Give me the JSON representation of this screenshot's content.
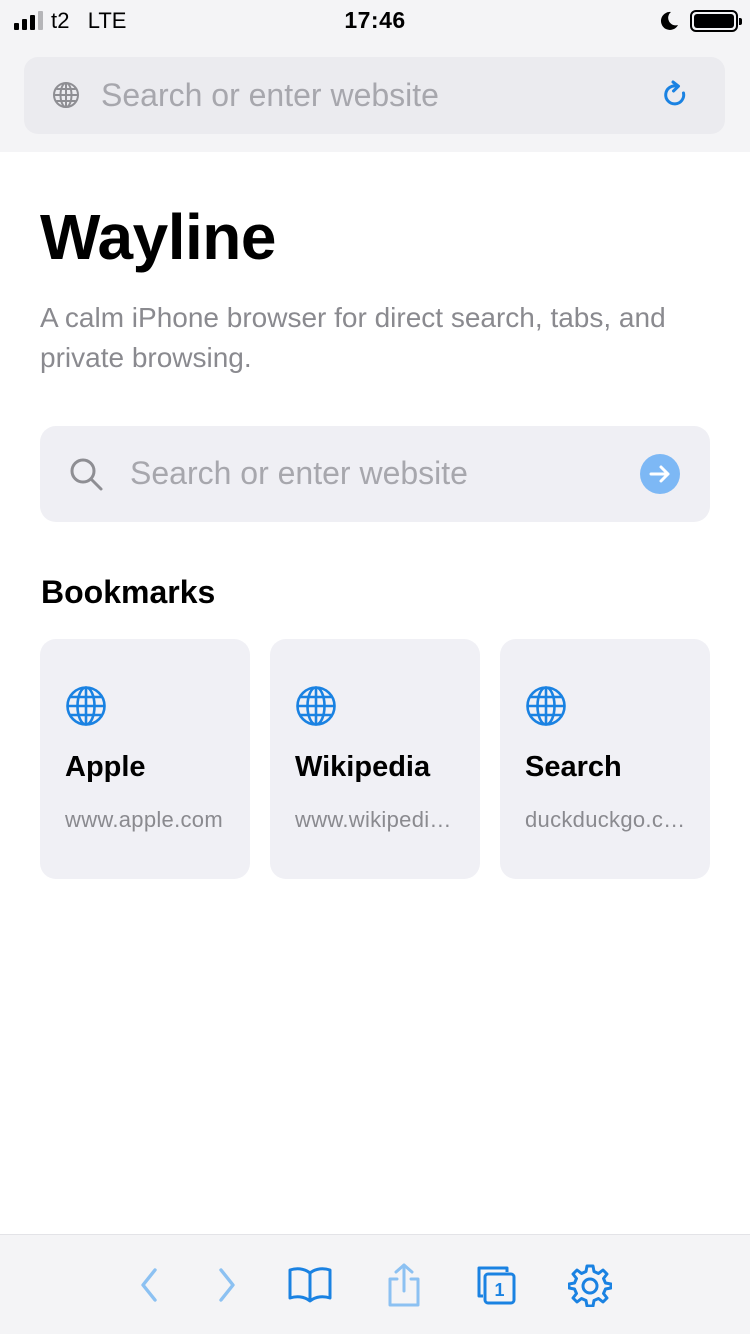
{
  "status_bar": {
    "carrier": "t2",
    "network": "LTE",
    "time": "17:46",
    "signal_bars_active": 3,
    "signal_bars_total": 4,
    "battery_level": 1.0
  },
  "top_bar": {
    "search_placeholder": "Search or enter website",
    "left_icon": "globe-icon",
    "right_icon": "reload-icon"
  },
  "home": {
    "title": "Wayline",
    "subtitle": "A calm iPhone browser for direct search, tabs, and private browsing.",
    "search": {
      "placeholder": "Search or enter website",
      "left_icon": "magnifier-icon",
      "submit_icon": "arrow-right-circle-icon"
    }
  },
  "bookmarks": {
    "title": "Bookmarks",
    "items": [
      {
        "name": "Apple",
        "url": "www.apple.com",
        "icon": "globe-icon"
      },
      {
        "name": "Wikipedia",
        "url": "www.wikipedia.org",
        "icon": "globe-icon"
      },
      {
        "name": "Search",
        "url": "duckduckgo.com",
        "icon": "globe-icon"
      }
    ]
  },
  "toolbar": {
    "buttons": [
      "back-icon",
      "forward-icon",
      "bookmarks-book-icon",
      "share-icon",
      "tabs-icon",
      "settings-gear-icon"
    ],
    "tab_count": "1"
  },
  "colors": {
    "accent": "#1a82e2",
    "accent_disabled": "#8cc1f2",
    "chrome_background": "#f4f4f6",
    "field_background": "#efeff4",
    "secondary_text": "#8a8a8f",
    "placeholder_text": "#a7a7ad"
  }
}
